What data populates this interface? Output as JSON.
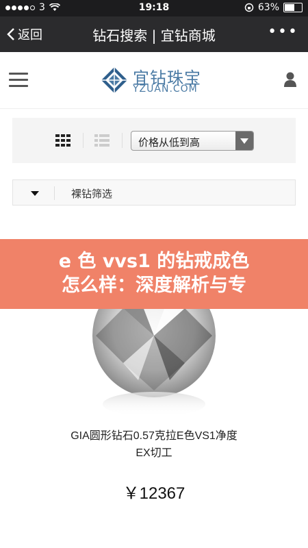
{
  "status_bar": {
    "carrier": "3",
    "time": "19:18",
    "battery_pct": "63%",
    "battery_level": 0.63
  },
  "nav": {
    "back_label": "返回",
    "title": "钻石搜索 | 宜钻商城"
  },
  "site": {
    "logo_name": "宜钻珠宝",
    "logo_domain": "YZUAN.COM"
  },
  "toolbar": {
    "sort_value": "价格从低到高"
  },
  "filter": {
    "label": "裸钻筛选"
  },
  "banner": {
    "line1": "e 色 vvs1 的钻戒成色",
    "line2": "怎么样：深度解析与专"
  },
  "product": {
    "title_line1": "GIA圆形钻石0.57克拉E色VS1净度",
    "title_line2": "EX切工",
    "price": "￥12367"
  },
  "colors": {
    "banner": "#f08268",
    "nav_bg": "#2b2b2d",
    "brand": "#4a7aa4"
  }
}
